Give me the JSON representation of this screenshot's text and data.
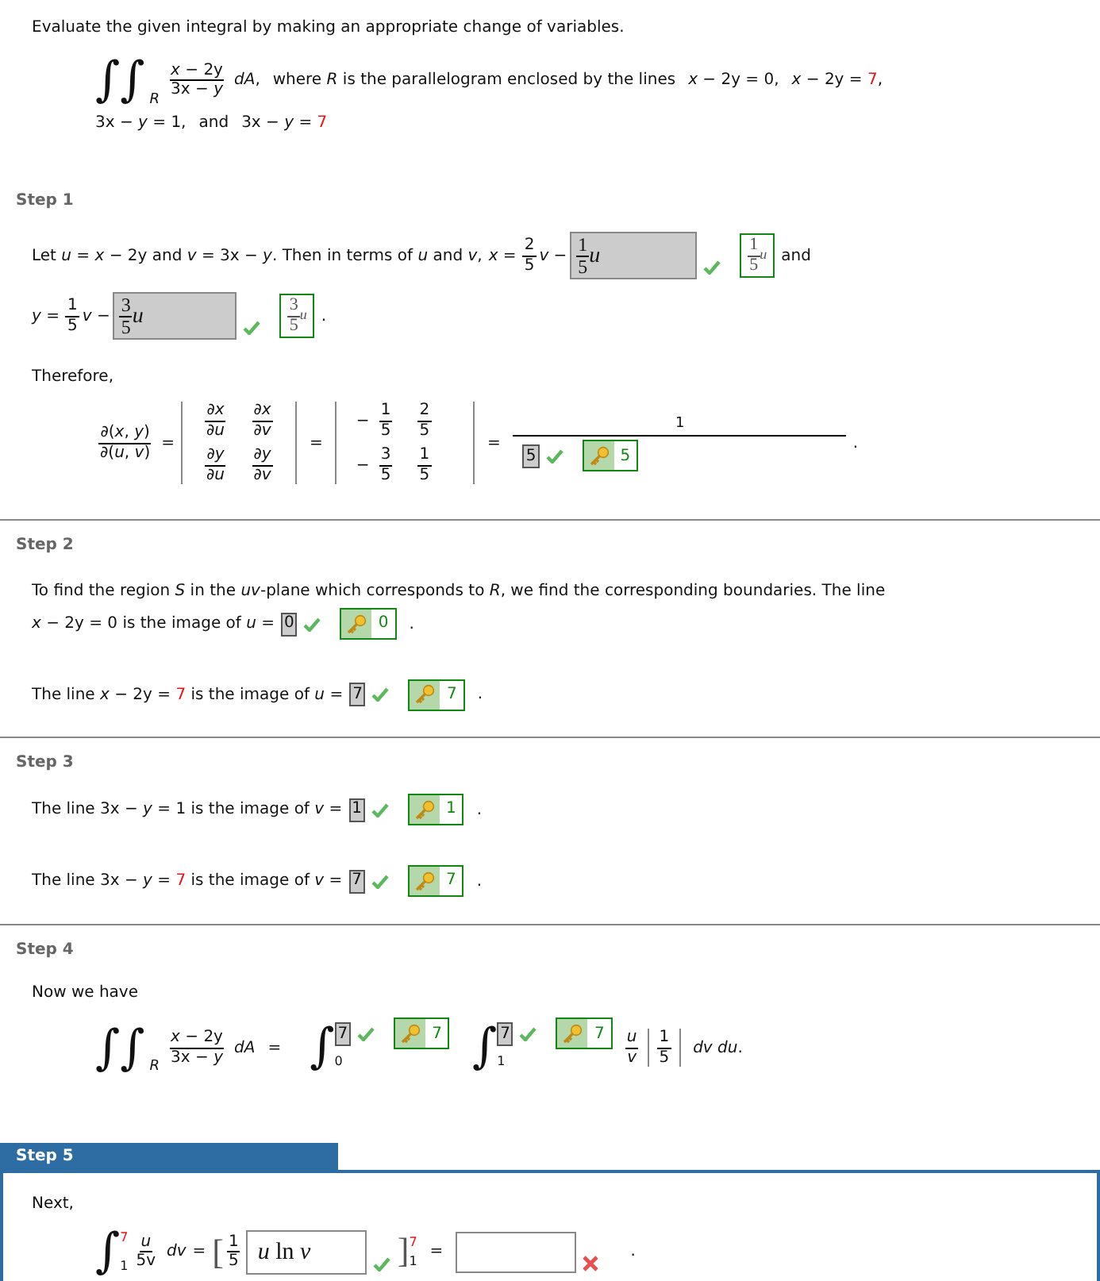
{
  "problem": {
    "instruction": "Evaluate the given integral by making an appropriate change of variables.",
    "integral": {
      "signs": "∫∫",
      "region": "R",
      "numerator": "*x* − 2y",
      "denominator": "3x − *y*",
      "differential": "*dA*,"
    },
    "description": "where *R* is the parallelogram enclosed by the lines",
    "boundaries": [
      {
        "segments": [
          {
            "text": "*x* − 2y = 0,",
            "kind": "plain"
          }
        ]
      },
      {
        "segments": [
          {
            "text": "*x* − 2y = ",
            "kind": "plain"
          },
          {
            "text": "7",
            "kind": "changed"
          },
          {
            "text": ",",
            "kind": "plain"
          }
        ]
      },
      {
        "segments": [
          {
            "text": "3x − *y* = 1,",
            "kind": "plain"
          }
        ]
      },
      {
        "segments": [
          {
            "text": "and",
            "kind": "plain"
          }
        ]
      },
      {
        "segments": [
          {
            "text": "3x − *y* = ",
            "kind": "plain"
          },
          {
            "text": "7",
            "kind": "changed"
          }
        ]
      }
    ]
  },
  "steps": [
    {
      "title": "Step 1",
      "selected": false,
      "kind": "substitution",
      "intro": "Let *u* = *x* − 2y and *v* = 3x − *y*. Then in terms of *u* and *v*,",
      "rows": [
        {
          "lhs": "*x* =",
          "coefficient": {
            "num": "2",
            "den": "5"
          },
          "variable": "*v* −",
          "answer": {
            "num": "1",
            "den": "5",
            "var": "u",
            "correct": true
          },
          "key": {
            "num": "1",
            "den": "5",
            "var": "u"
          },
          "tail": "and"
        },
        {
          "lhs": "*y* =",
          "coefficient": {
            "num": "1",
            "den": "5"
          },
          "variable": "*v* −",
          "answer": {
            "num": "3",
            "den": "5",
            "var": "u",
            "correct": true
          },
          "key": {
            "num": "3",
            "den": "5",
            "var": "u"
          },
          "tail": "."
        }
      ],
      "therefore": "Therefore,",
      "jacobian": {
        "lhs": {
          "num": "∂(*x*, *y*)",
          "den": "∂(*u*, *v*)"
        },
        "equals": [
          "=",
          "=",
          "="
        ],
        "partials": [
          [
            {
              "num": "∂*x*",
              "den": "∂*u*"
            },
            {
              "num": "∂*x*",
              "den": "∂*v*"
            }
          ],
          [
            {
              "num": "∂*y*",
              "den": "∂*u*"
            },
            {
              "num": "∂*y*",
              "den": "∂*v*"
            }
          ]
        ],
        "matrix": [
          [
            {
              "sign": "−",
              "num": "1",
              "den": "5"
            },
            {
              "num": "2",
              "den": "5"
            }
          ],
          [
            {
              "sign": "−",
              "num": "3",
              "den": "5"
            },
            {
              "num": "1",
              "den": "5"
            }
          ]
        ],
        "result": {
          "num": "1",
          "answer": "5",
          "correct": true,
          "key": "5"
        },
        "end": "."
      }
    },
    {
      "title": "Step 2",
      "selected": false,
      "kind": "boundaries",
      "statements": [
        {
          "lead": "To find the region *S* in the *uv*-plane which corresponds to *R*, we find the corresponding boundaries. The line",
          "segments": [
            {
              "text": "*x* − 2y = 0 is the image of *u* =",
              "kind": "plain"
            }
          ],
          "answer": "0",
          "correct": true,
          "key": "0",
          "end": "."
        },
        {
          "segments": [
            {
              "text": "The line *x* − 2y = ",
              "kind": "plain"
            },
            {
              "text": "7",
              "kind": "changed"
            },
            {
              "text": " is the image of *u* =",
              "kind": "plain"
            }
          ],
          "answer": "7",
          "correct": true,
          "key": "7",
          "end": "."
        }
      ]
    },
    {
      "title": "Step 3",
      "selected": false,
      "kind": "boundaries",
      "statements": [
        {
          "segments": [
            {
              "text": "The line 3x − *y* = 1 is the image of *v* =",
              "kind": "plain"
            }
          ],
          "answer": "1",
          "correct": true,
          "key": "1",
          "end": "."
        },
        {
          "segments": [
            {
              "text": "The line 3x − *y* = ",
              "kind": "plain"
            },
            {
              "text": "7",
              "kind": "changed"
            },
            {
              "text": " is the image of *v* =",
              "kind": "plain"
            }
          ],
          "answer": "7",
          "correct": true,
          "key": "7",
          "end": "."
        }
      ]
    },
    {
      "title": "Step 4",
      "selected": false,
      "kind": "limits",
      "intro": "Now we have",
      "integral": {
        "signs": "∫∫",
        "region": "R",
        "numerator": "*x* − 2y",
        "denominator": "3x − *y*",
        "differential": "*dA*"
      },
      "equals": "=",
      "outer": {
        "sign": "∫",
        "lower": "0",
        "answer": "7",
        "correct": true,
        "key": "7"
      },
      "inner": {
        "sign": "∫",
        "lower": "1",
        "answer": "7",
        "correct": true,
        "key": "7"
      },
      "integrand": {
        "num": "*u*",
        "den": "*v*"
      },
      "factor": {
        "num": "1",
        "den": "5"
      },
      "differentials": "*dv du*."
    },
    {
      "title": "Step 5",
      "selected": true,
      "kind": "evaluation",
      "intro": "Next,",
      "integral": {
        "sign": "∫",
        "lower": "1",
        "upper": "7",
        "num": "*u*",
        "den": "5v",
        "differential": "*dv*"
      },
      "equals": [
        "=",
        "="
      ],
      "bracket": {
        "open": "[",
        "coefficient": {
          "num": "1",
          "den": "5"
        },
        "answer": "*u* ln *v*",
        "correct": true,
        "close": "]",
        "upper": "7",
        "lower": "1"
      },
      "result": {
        "correct": false
      },
      "end": "."
    }
  ]
}
